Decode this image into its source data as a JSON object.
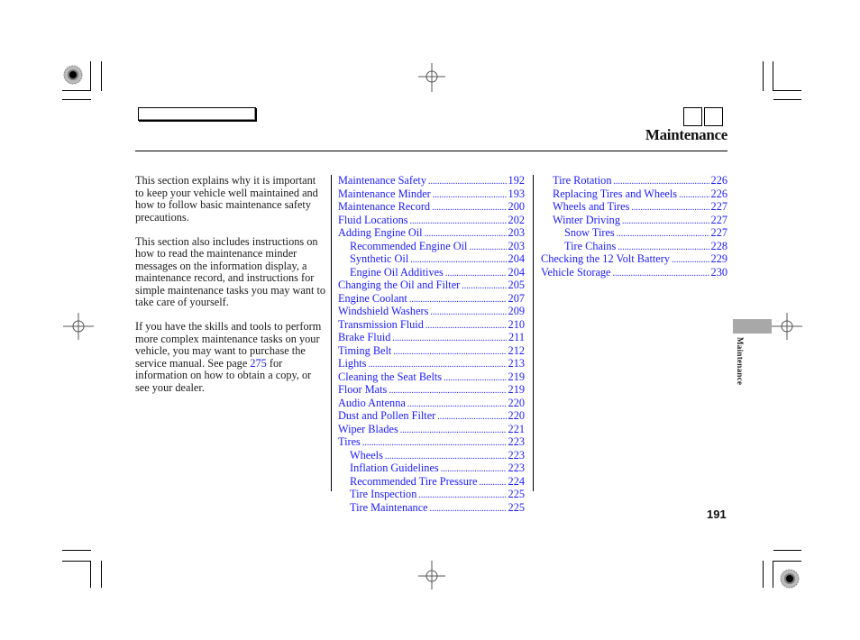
{
  "header": {
    "section_title": "Maintenance"
  },
  "intro": {
    "paragraphs": [
      "This section explains why it is important to keep your vehicle well maintained and how to follow basic maintenance safety precautions.",
      "This section also includes instructions on how to read the maintenance minder messages on the information display, a maintenance record, and instructions for simple maintenance tasks you may want to take care of yourself."
    ],
    "para3_before": "If you have the skills and tools to perform more complex maintenance tasks on your vehicle, you may want to purchase the service manual. See page ",
    "para3_link": "275",
    "para3_after": " for information on how to obtain a copy, or see your dealer."
  },
  "toc_col1": [
    {
      "label": "Maintenance Safety",
      "page": "192",
      "level": 0
    },
    {
      "label": "Maintenance Minder",
      "page": "193",
      "level": 0
    },
    {
      "label": "Maintenance Record",
      "page": "200",
      "level": 0
    },
    {
      "label": "Fluid Locations",
      "page": "202",
      "level": 0
    },
    {
      "label": "Adding Engine Oil",
      "page": "203",
      "level": 0
    },
    {
      "label": "Recommended Engine Oil",
      "page": "203",
      "level": 1
    },
    {
      "label": "Synthetic Oil",
      "page": "204",
      "level": 1
    },
    {
      "label": "Engine Oil Additives",
      "page": "204",
      "level": 1
    },
    {
      "label": "Changing the Oil and Filter",
      "page": "205",
      "level": 0
    },
    {
      "label": "Engine Coolant",
      "page": "207",
      "level": 0
    },
    {
      "label": "Windshield Washers",
      "page": "209",
      "level": 0
    },
    {
      "label": "Transmission Fluid",
      "page": "210",
      "level": 0
    },
    {
      "label": "Brake Fluid",
      "page": "211",
      "level": 0
    },
    {
      "label": "Timing Belt",
      "page": "212",
      "level": 0
    },
    {
      "label": "Lights",
      "page": "213",
      "level": 0
    },
    {
      "label": "Cleaning the Seat Belts",
      "page": "219",
      "level": 0
    },
    {
      "label": "Floor Mats",
      "page": "219",
      "level": 0
    },
    {
      "label": "Audio Antenna",
      "page": "220",
      "level": 0
    },
    {
      "label": "Dust and Pollen Filter",
      "page": "220",
      "level": 0
    },
    {
      "label": "Wiper Blades",
      "page": "221",
      "level": 0
    },
    {
      "label": "Tires",
      "page": "223",
      "level": 0
    },
    {
      "label": "Wheels",
      "page": "223",
      "level": 1
    },
    {
      "label": "Inflation Guidelines",
      "page": "223",
      "level": 1
    },
    {
      "label": "Recommended Tire Pressure",
      "page": "224",
      "level": 1
    },
    {
      "label": "Tire Inspection",
      "page": "225",
      "level": 1
    },
    {
      "label": "Tire Maintenance",
      "page": "225",
      "level": 1
    }
  ],
  "toc_col2": [
    {
      "label": "Tire Rotation",
      "page": "226",
      "level": 1
    },
    {
      "label": "Replacing Tires and Wheels",
      "page": "226",
      "level": 1
    },
    {
      "label": "Wheels and Tires",
      "page": "227",
      "level": 1
    },
    {
      "label": "Winter Driving",
      "page": "227",
      "level": 1
    },
    {
      "label": "Snow Tires",
      "page": "227",
      "level": 2
    },
    {
      "label": "Tire Chains",
      "page": "228",
      "level": 2
    },
    {
      "label": "Checking the 12 Volt Battery",
      "page": "229",
      "level": 0
    },
    {
      "label": "Vehicle Storage",
      "page": "230",
      "level": 0
    }
  ],
  "side_tab": {
    "label": "Maintenance"
  },
  "footer": {
    "page_number": "191"
  },
  "colors": {
    "link": "#1a1aff",
    "side_tab": "#a8a8a8"
  }
}
